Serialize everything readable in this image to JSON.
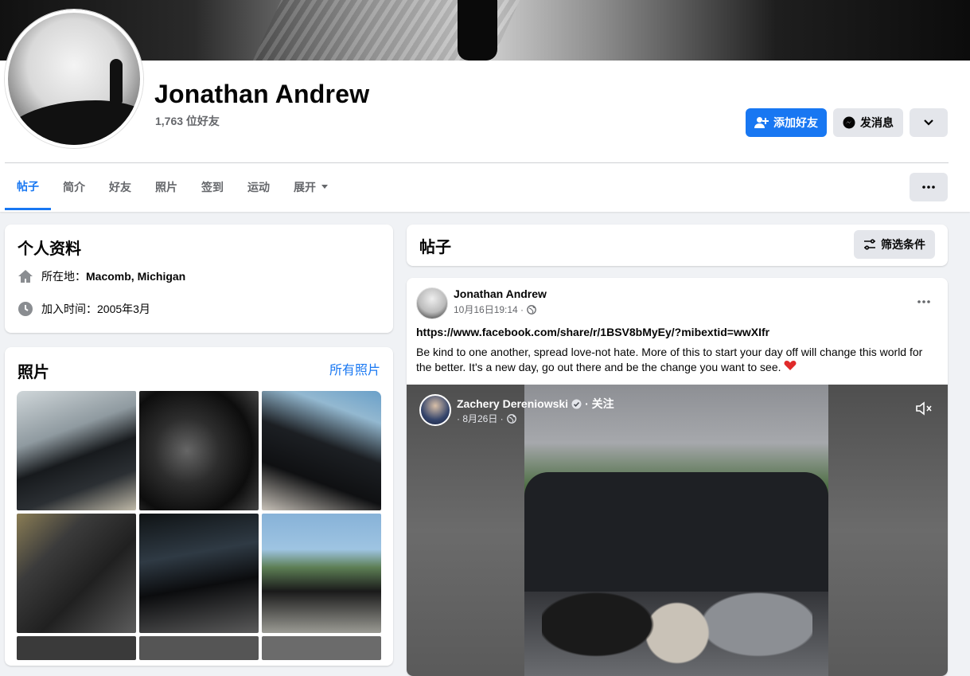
{
  "profile": {
    "name": "Jonathan Andrew",
    "friends_count": "1,763 位好友"
  },
  "actions": {
    "add_friend": "添加好友",
    "message": "发消息"
  },
  "tabs": [
    "帖子",
    "简介",
    "好友",
    "照片",
    "签到",
    "运动",
    "展开"
  ],
  "intro": {
    "title": "个人资料",
    "location_label": "所在地：",
    "location_value": "Macomb, Michigan",
    "joined_text": "加入时间：2005年3月"
  },
  "photos": {
    "title": "照片",
    "all_link": "所有照片"
  },
  "posts": {
    "title": "帖子",
    "filter_label": "筛选条件"
  },
  "post": {
    "author": "Jonathan Andrew",
    "date": "10月16日19:14 ·",
    "link": "https://www.facebook.com/share/r/1BSV8bMyEy/?mibextid=wwXIfr",
    "text": "Be kind to one another, spread love-not hate. More of this to start your day off will change this world for the better. It's a new day, go out there and be the change you want to see.",
    "video": {
      "author": "Zachery Dereniowski",
      "follow": "· 关注",
      "date": "· 8月26日 ·"
    }
  },
  "colors": {
    "accent": "#1877f2",
    "background": "#f0f2f5",
    "secondary_button": "#e4e6eb"
  }
}
